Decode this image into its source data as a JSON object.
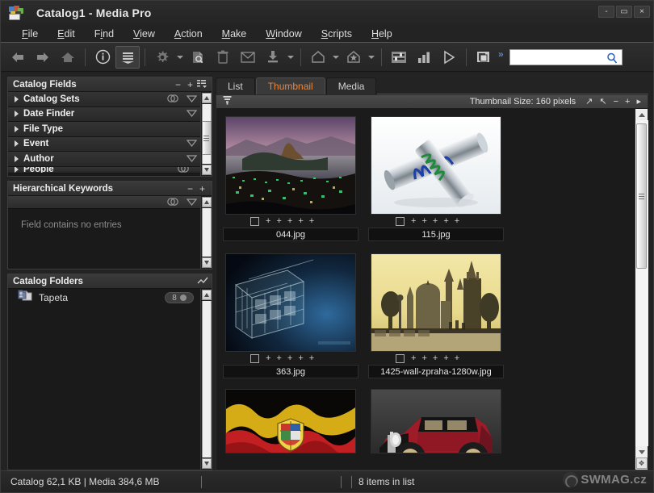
{
  "window": {
    "title": "Catalog1 - Media Pro",
    "app_icon": "media-pro-icon",
    "minimize": "-",
    "maximize": "▭",
    "close": "×"
  },
  "menubar": {
    "items": [
      {
        "label": "File",
        "accel": "F"
      },
      {
        "label": "Edit",
        "accel": "E"
      },
      {
        "label": "Find",
        "accel": "i"
      },
      {
        "label": "View",
        "accel": "V"
      },
      {
        "label": "Action",
        "accel": "A"
      },
      {
        "label": "Make",
        "accel": "M"
      },
      {
        "label": "Window",
        "accel": "W"
      },
      {
        "label": "Scripts",
        "accel": "S"
      },
      {
        "label": "Help",
        "accel": "H"
      }
    ]
  },
  "toolbar": {
    "buttons": [
      {
        "name": "back-arrow-icon",
        "active": false
      },
      {
        "name": "forward-arrow-icon",
        "active": false
      },
      {
        "name": "home-icon",
        "active": false
      },
      {
        "name": "info-icon",
        "active": false
      },
      {
        "name": "stack-list-icon",
        "active": true
      },
      {
        "name": "gear-icon",
        "active": false
      },
      {
        "name": "document-search-icon",
        "active": false
      },
      {
        "name": "trash-icon",
        "active": false
      },
      {
        "name": "envelope-icon",
        "active": false
      },
      {
        "name": "import-icon",
        "active": false
      },
      {
        "name": "label-icon",
        "active": false
      },
      {
        "name": "star-icon",
        "active": false
      },
      {
        "name": "slideshow-settings-icon",
        "active": false
      },
      {
        "name": "bar-chart-icon",
        "active": false
      },
      {
        "name": "play-icon",
        "active": false
      },
      {
        "name": "panes-icon",
        "active": false
      }
    ],
    "overflow_label": "»",
    "search": {
      "value": "",
      "placeholder": "",
      "icon": "magnifier-icon"
    }
  },
  "sidebar": {
    "catalog_fields": {
      "title": "Catalog Fields",
      "buttons": {
        "minus": "−",
        "plus": "+",
        "options": "list-options-icon"
      },
      "rows": [
        {
          "label": "Catalog Sets",
          "has_link_icon": true,
          "has_menu": true
        },
        {
          "label": "Date Finder",
          "has_link_icon": false,
          "has_menu": true
        },
        {
          "label": "File Type",
          "has_link_icon": false,
          "has_menu": false
        },
        {
          "label": "Event",
          "has_link_icon": false,
          "has_menu": true
        },
        {
          "label": "Author",
          "has_link_icon": false,
          "has_menu": true
        },
        {
          "label": "People",
          "has_link_icon": true,
          "has_menu": true
        }
      ]
    },
    "hierarchical_keywords": {
      "title": "Hierarchical Keywords",
      "buttons": {
        "minus": "−",
        "plus": "+"
      },
      "empty_text": "Field contains no entries"
    },
    "catalog_folders": {
      "title": "Catalog Folders",
      "buttons": {
        "options": "edit-path-icon"
      },
      "items": [
        {
          "label": "Tapeta",
          "count": "8",
          "icon": "folder-shortcut-icon"
        }
      ]
    }
  },
  "main": {
    "tabs": [
      {
        "label": "List",
        "active": false
      },
      {
        "label": "Thumbnail",
        "active": true
      },
      {
        "label": "Media",
        "active": false
      }
    ],
    "subbar": {
      "filter_icon": "filter-icon",
      "thumbnail_size_label": "Thumbnail Size: 160 pixels",
      "icons": [
        {
          "name": "expand-arrow-icon",
          "glyph": "↗"
        },
        {
          "name": "collapse-arrow-icon",
          "glyph": "↖"
        },
        {
          "name": "decrease-size-icon",
          "glyph": "−"
        },
        {
          "name": "increase-size-icon",
          "glyph": "+"
        },
        {
          "name": "next-icon",
          "glyph": "▸"
        }
      ]
    },
    "thumbnails": [
      {
        "filename": "044.jpg",
        "art": "rio",
        "rating_marks": 5,
        "checked": false
      },
      {
        "filename": "115.jpg",
        "art": "coils",
        "rating_marks": 5,
        "checked": false
      },
      {
        "filename": "363.jpg",
        "art": "cube",
        "rating_marks": 5,
        "checked": false
      },
      {
        "filename": "1425-wall-zpraha-1280w.jpg",
        "art": "prague",
        "rating_marks": 5,
        "checked": false
      },
      {
        "filename": "",
        "art": "flag",
        "rating_marks": 0,
        "checked": false
      },
      {
        "filename": "",
        "art": "car",
        "rating_marks": 0,
        "checked": false
      }
    ],
    "rating_mark": "+"
  },
  "statusbar": {
    "catalog_info": "Catalog  62,1 KB  |  Media 384,6 MB",
    "items_in_list": "8 items in list",
    "watermark": "SWMAG.cz"
  },
  "colors": {
    "accent_orange": "#e8873a",
    "window_bg": "#232323",
    "panel_bg": "#1d1d1d",
    "link_blue": "#5b86c9"
  }
}
